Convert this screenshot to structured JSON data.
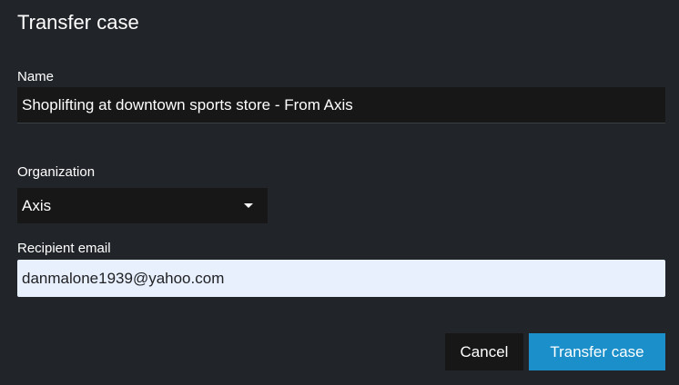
{
  "dialog": {
    "title": "Transfer case"
  },
  "name_field": {
    "label": "Name",
    "value": "Shoplifting at downtown sports store - From Axis"
  },
  "organization_field": {
    "label": "Organization",
    "selected": "Axis",
    "icon": "chevron-down-icon"
  },
  "email_field": {
    "label": "Recipient email",
    "value": "danmalone1939@yahoo.com"
  },
  "actions": {
    "cancel_label": "Cancel",
    "transfer_label": "Transfer case"
  },
  "colors": {
    "background": "#212529",
    "field_background": "#171717",
    "autofill_background": "#e8f0fe",
    "primary_button": "#1a8fc9"
  }
}
